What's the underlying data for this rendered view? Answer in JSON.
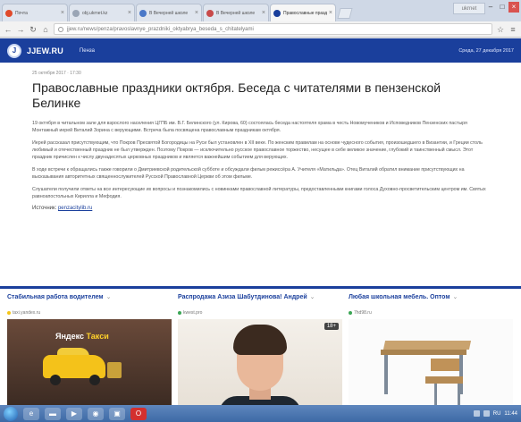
{
  "browser": {
    "tabs": [
      {
        "title": "Почта",
        "icon_color": "#e04a2a",
        "active": false
      },
      {
        "title": "obj.ukrnet.kz",
        "icon_color": "#9aa5b5",
        "active": false
      },
      {
        "title": "В Вечерней школе",
        "icon_color": "#4a78c8",
        "active": false
      },
      {
        "title": "В Вечерней школе",
        "icon_color": "#c84a4a",
        "active": false
      },
      {
        "title": "Православные праздн...",
        "icon_color": "#1a3f9c",
        "active": true
      }
    ],
    "user_badge": "ukrnet",
    "address": "jjew.ru/news/penza/pravoslavnye_prazdniki_oktyabrya_beseda_s_chitatelyami"
  },
  "site": {
    "logo_letter": "J",
    "name": "JJEW.RU",
    "nav_penza": "Пенза",
    "header_date": "Среда, 27 декабря 2017"
  },
  "article": {
    "meta": "25 октября 2017 · 17:30",
    "title": "Православные праздники октября. Беседа с читателями в пензенской Белинке",
    "paragraphs": [
      "19 октября в читальном зале для взрослого населения ЦГПБ им. В.Г. Белинского (ул. Кирова, 60) состоялась беседа настоятеля храма в честь Новомучеников и Исповедников Пензенских пастыря Монтажный иерей Виталий Зорина с верующими. Встреча была посвящена православным праздникам октября.",
      "Иерей рассказал присутствующим, что Покров Пресвятой Богородицы на Руси был установлен в XII веке. По женским правилам на основе чудесного события, произошедшего в Византии, и Греции столь любимый и отечественный праздник не был утвержден. Поэтому Покров — исключительно русское православное торжество, несущее в себе великое значение, глубокий и таинственный смысл. Этот праздник причислен к числу двунадесятых церковных праздников и является важнейшим событием для верующих.",
      "В ходе встречи к обращались также говорили о Дмитриевской родительской субботе и обсуждали фильм режиссёра А. Учителя «Матильда». Отец Виталий обратил внимание присутствующих на высказывания авторитетных священнослужителей Русской Православной Церкви об этом фильме.",
      "Слушатели получили ответы на все интересующие их вопросы и познакомились с новинками православной литературы, предоставленными книгами голоса Духовно-просветительским центром им. Святых равноапостольных Кирилла и Мефодия."
    ],
    "source_label": "Источник:",
    "source_link": "penzacitylib.ru"
  },
  "ads": [
    {
      "title": "Стабильная работа водителем",
      "domain": "taxi.yandex.ru",
      "fav_color": "#f5c518",
      "image_text_a": "Яндекс",
      "image_text_b": "Такси"
    },
    {
      "title": "Распродажа Азиза Шабутдинова! Андрей",
      "domain": "kwest.pro",
      "fav_color": "#3aa655",
      "age_badge": "18+"
    },
    {
      "title": "Любая школьная мебель. Оптом",
      "domain": "7hd98.ru",
      "fav_color": "#3aa655"
    }
  ],
  "taskbar": {
    "tray_lang": "RU",
    "tray_time": "11:44"
  }
}
